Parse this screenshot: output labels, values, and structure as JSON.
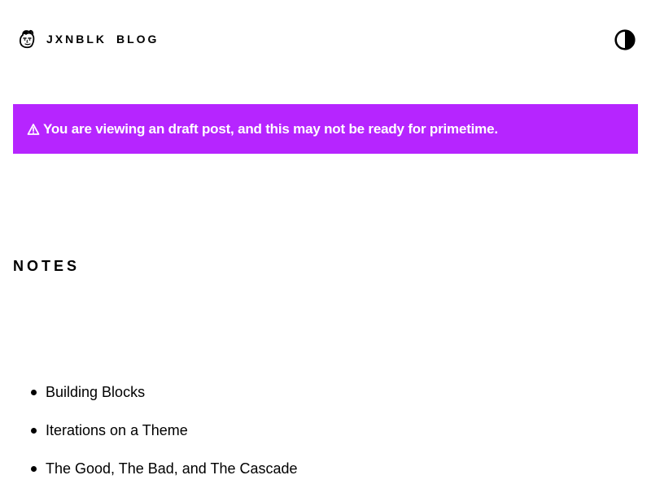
{
  "header": {
    "logo_icon": "cartoon-face-icon",
    "site_name": "JXNBLK",
    "nav_blog": "BLOG",
    "theme_toggle_icon": "contrast-icon"
  },
  "banner": {
    "icon": "warning-triangle-icon",
    "message": "You are viewing an draft post, and this may not be ready for primetime.",
    "background_color": "#b625ff",
    "text_color": "#ffffff"
  },
  "main": {
    "heading": "NOTES",
    "notes": [
      {
        "title": "Building Blocks"
      },
      {
        "title": "Iterations on a Theme"
      },
      {
        "title": "The Good, The Bad, and The Cascade"
      }
    ]
  }
}
